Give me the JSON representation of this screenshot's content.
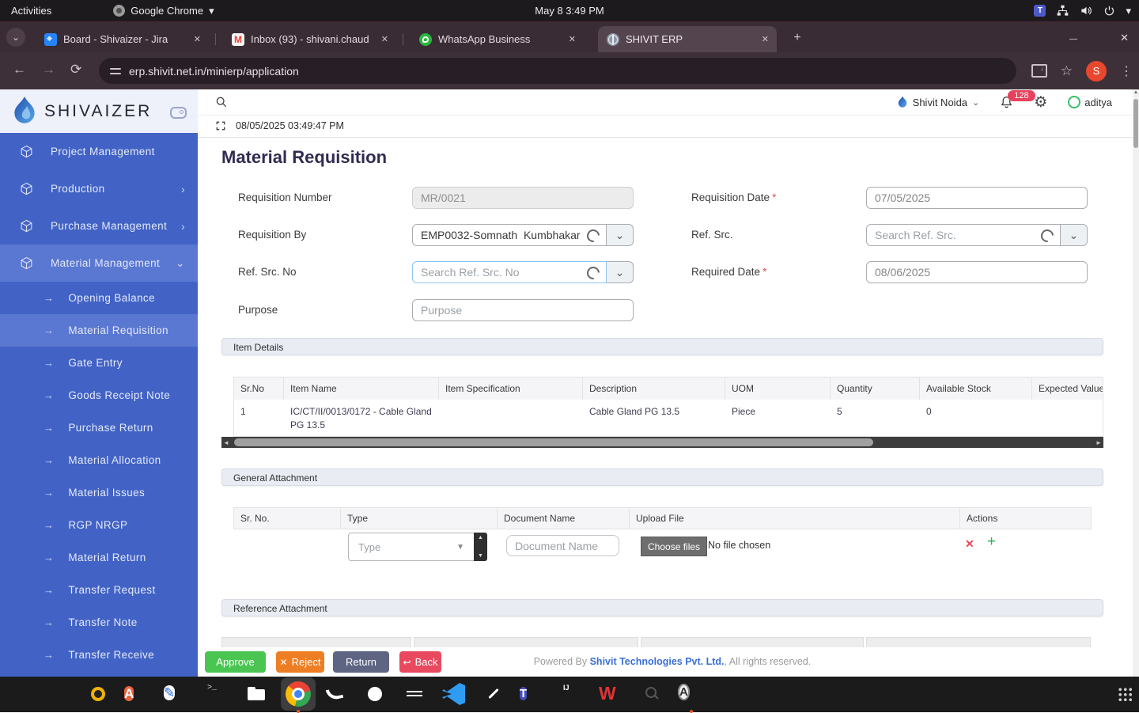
{
  "system_bar": {
    "activities_label": "Activities",
    "app_name": "Google Chrome",
    "clock": "May 8  3:49 PM"
  },
  "browser": {
    "tabs": [
      {
        "title": "Board - Shivaizer - Jira",
        "icon": "jira"
      },
      {
        "title": "Inbox (93) - shivani.chaud",
        "icon": "gmail"
      },
      {
        "title": "WhatsApp Business",
        "icon": "whatsapp"
      },
      {
        "title": "SHIVIT ERP",
        "icon": "globe"
      }
    ],
    "url": "erp.shivit.net.in/minierp/application",
    "profile_initial": "S"
  },
  "sidebar": {
    "brand": "SHIVAIZER",
    "items": [
      {
        "label": "Project Management"
      },
      {
        "label": "Production"
      },
      {
        "label": "Purchase Management"
      },
      {
        "label": "Material Management"
      }
    ],
    "subitems": [
      {
        "label": "Opening Balance"
      },
      {
        "label": "Material Requisition"
      },
      {
        "label": "Gate Entry"
      },
      {
        "label": "Goods Receipt Note"
      },
      {
        "label": "Purchase Return"
      },
      {
        "label": "Material Allocation"
      },
      {
        "label": "Material Issues"
      },
      {
        "label": "RGP NRGP"
      },
      {
        "label": "Material Return"
      },
      {
        "label": "Transfer Request"
      },
      {
        "label": "Transfer Note"
      },
      {
        "label": "Transfer Receive"
      }
    ]
  },
  "header": {
    "org": "Shivit Noida",
    "notification_count": "128",
    "user": "aditya",
    "timestamp": "08/05/2025 03:49:47 PM"
  },
  "page": {
    "title": "Material Requisition",
    "fields": {
      "requisition_number": {
        "label": "Requisition Number",
        "value": "MR/0021"
      },
      "requisition_date": {
        "label": "Requisition Date",
        "required": "*",
        "value": "07/05/2025"
      },
      "requisition_by": {
        "label": "Requisition By",
        "value": "EMP0032-Somnath  Kumbhakar"
      },
      "ref_src": {
        "label": "Ref. Src.",
        "placeholder": "Search Ref. Src."
      },
      "ref_src_no": {
        "label": "Ref. Src. No",
        "placeholder": "Search Ref. Src. No"
      },
      "required_date": {
        "label": "Required Date",
        "required": "*",
        "value": "08/06/2025"
      },
      "purpose": {
        "label": "Purpose",
        "placeholder": "Purpose"
      }
    },
    "item_details": {
      "section_title": "Item Details",
      "columns": [
        "Sr.No",
        "Item Name",
        "Item Specification",
        "Description",
        "UOM",
        "Quantity",
        "Available Stock",
        "Expected Value"
      ],
      "rows": [
        [
          "1",
          "IC/CT/II/0013/0172 - Cable Gland PG 13.5",
          "",
          "Cable Gland PG 13.5",
          "Piece",
          "5",
          "0",
          ""
        ]
      ]
    },
    "general_attachment": {
      "section_title": "General Attachment",
      "columns": [
        "Sr. No.",
        "Type",
        "Document Name",
        "Upload File",
        "Actions"
      ],
      "type_placeholder": "Type",
      "doc_name_placeholder": "Document Name",
      "choose_files_label": "Choose files",
      "no_file_text": "No file chosen"
    },
    "reference_attachment": {
      "section_title": "Reference Attachment"
    },
    "actions": {
      "approve": "Approve",
      "reject": "Reject",
      "return": "Return",
      "back": "Back"
    },
    "footer": {
      "prefix": "Powered By ",
      "link": "Shivit Technologies Pvt. Ltd.",
      "suffix": ", All rights reserved."
    }
  },
  "colors": {
    "sidebar_blue": "#4263c5",
    "sidebar_highlight": "#5a77d1",
    "active_marker_red": "#d94656",
    "badge_red": "#e8415c",
    "approve_green": "#4bc552",
    "reject_orange": "#ee7e23",
    "return_slate": "#5d6583",
    "back_red": "#e8495f",
    "footer_link_blue": "#3a6fd8"
  },
  "taskbar": {
    "apps": [
      "firefox",
      "thunderbird",
      "rhythmbox",
      "ubuntu-software",
      "text-editor",
      "terminal",
      "files",
      "chrome",
      "mysql-workbench",
      "github",
      "eclipse",
      "vscode",
      "postman",
      "teams",
      "intellij",
      "wps-office",
      "screenshot-tool",
      "app-a",
      "show-apps"
    ]
  }
}
